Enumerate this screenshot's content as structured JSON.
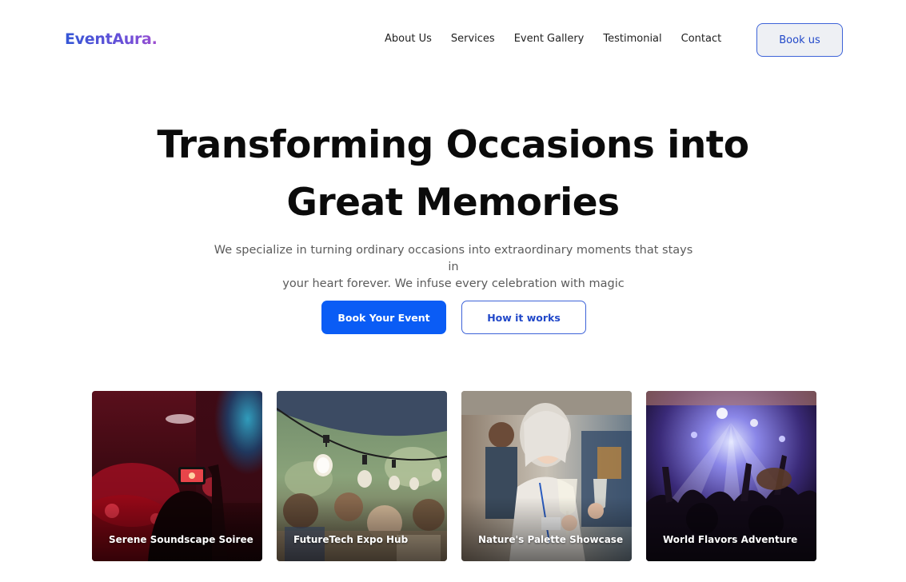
{
  "header": {
    "logo": "EventAura.",
    "nav": [
      "About Us",
      "Services",
      "Event Gallery",
      "Testimonial",
      "Contact"
    ],
    "cta_label": "Book us"
  },
  "hero": {
    "title_line1": "Transforming Occasions into",
    "title_line2": "Great Memories",
    "subtitle_line1": "We specialize in turning ordinary occasions into extraordinary moments that stays in",
    "subtitle_line2": "your heart forever. We infuse every celebration with magic",
    "primary_button": "Book Your Event",
    "secondary_button": "How it works"
  },
  "gallery": [
    {
      "title": "Serene Soundscape Soiree",
      "icon": "concert-phone-photo"
    },
    {
      "title": "FutureTech Expo Hub",
      "icon": "string-lights-photo"
    },
    {
      "title": "Nature's Palette Showcase",
      "icon": "champagne-toast-photo"
    },
    {
      "title": "World Flavors Adventure",
      "icon": "festival-crowd-photo"
    }
  ],
  "colors": {
    "accent": "#0a5cf5",
    "outline": "#3d63d8",
    "logo_gradient_start": "#3457d6",
    "logo_gradient_end": "#a04fd0"
  }
}
